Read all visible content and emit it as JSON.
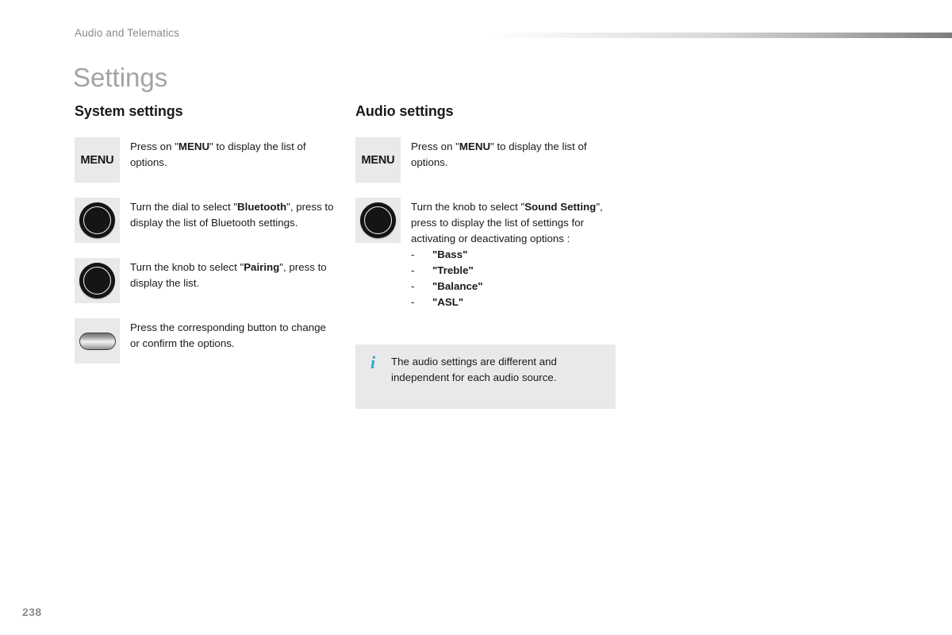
{
  "document": {
    "chapter": "Audio and Telematics",
    "title": "Settings",
    "page_number": "238"
  },
  "colors": {
    "title_gray": "#a3a3a3",
    "chapter_gray": "#8a8a8a",
    "icon_box_gray": "#e9e9e9",
    "info_accent": "#29abca",
    "body_text": "#1a1a1a"
  },
  "columns": {
    "left": {
      "heading": "System settings",
      "rows": [
        {
          "icon": "menu-key-icon",
          "icon_label": "MENU",
          "text_prefix": "Press on \"",
          "text_bold": "MENU",
          "text_suffix": "\" to display the list of options."
        },
        {
          "icon": "rotary-knob-icon",
          "icon_label": "",
          "text_prefix": "Turn the dial to select \"",
          "text_bold": "Bluetooth",
          "text_suffix": "\", press to display the list of Bluetooth settings."
        },
        {
          "icon": "rotary-knob-icon",
          "icon_label": "",
          "text_prefix": "Turn the knob to select \"",
          "text_bold": "Pairing",
          "text_suffix": "\", press to display the list."
        },
        {
          "icon": "push-button-icon",
          "icon_label": "",
          "text_prefix": "Press the corresponding button to change or confirm the options.",
          "text_bold": "",
          "text_suffix": ""
        }
      ]
    },
    "right": {
      "heading": "Audio settings",
      "rows": [
        {
          "icon": "menu-key-icon",
          "icon_label": "MENU",
          "text_prefix": "Press on \"",
          "text_bold": "MENU",
          "text_suffix": "\" to display the list of options."
        },
        {
          "icon": "rotary-knob-icon",
          "icon_label": "",
          "text_prefix": "Turn the knob to select \"",
          "text_bold": "Sound Setting",
          "text_suffix": "\", press to display the list of settings for activating or deactivating options :"
        }
      ],
      "bullets": [
        {
          "dash": "-",
          "term": "\"Bass\""
        },
        {
          "dash": "-",
          "term": "\"Treble\""
        },
        {
          "dash": "-",
          "term": "\"Balance\""
        },
        {
          "dash": "-",
          "term": "\"ASL\""
        }
      ],
      "info": {
        "icon": "information-icon",
        "icon_glyph": "i",
        "text": "The audio settings are different and independent for each audio source."
      }
    }
  }
}
